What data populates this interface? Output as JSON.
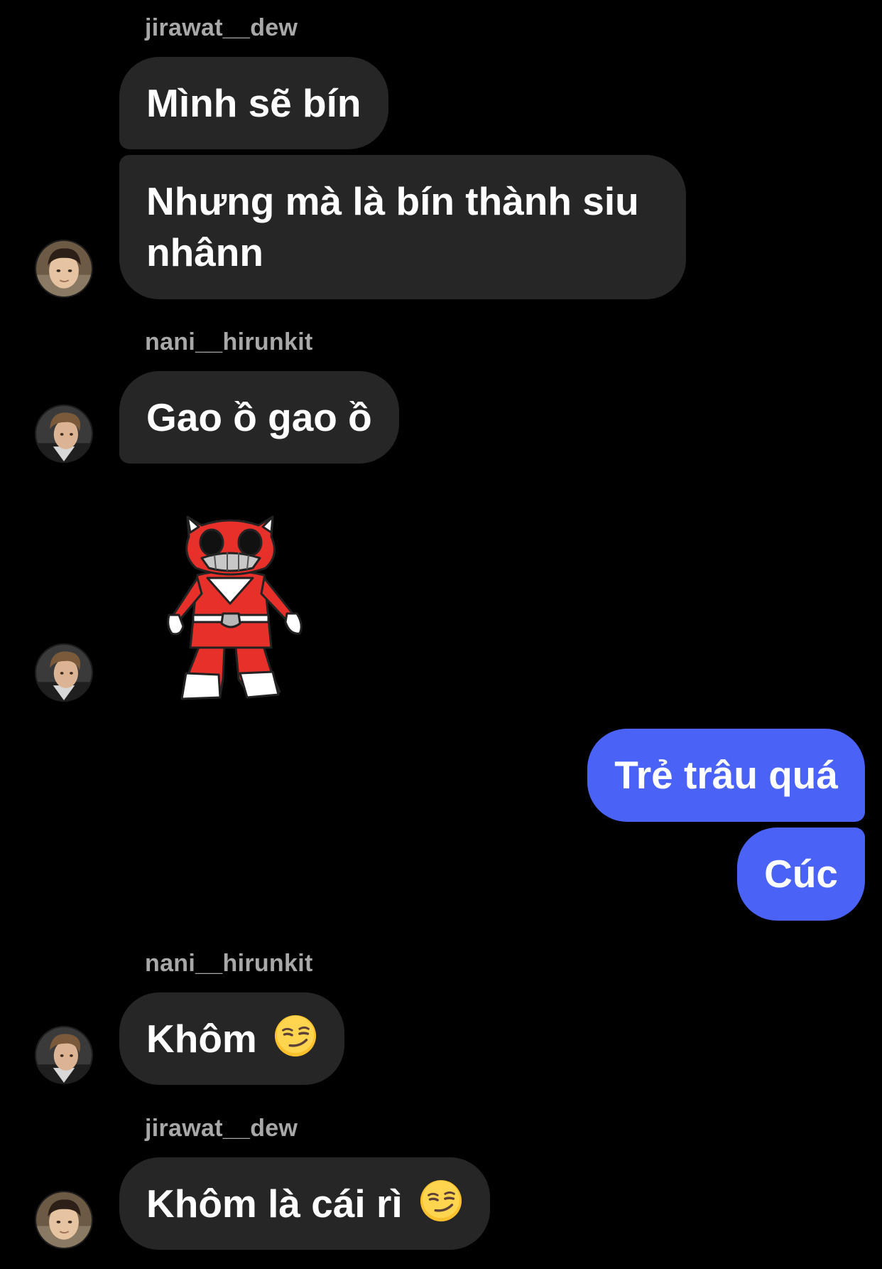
{
  "thread": {
    "groups": [
      {
        "sender": "jirawat__dew",
        "messages": [
          "Mình sẽ bín",
          "Nhưng mà là bín thành siu nhânn"
        ]
      },
      {
        "sender": "nani__hirunkit",
        "messages": [
          "Gao ồ gao ồ"
        ],
        "sticker": "red-ranger-cat-sticker"
      },
      {
        "outgoing": true,
        "messages": [
          "Trẻ trâu quá",
          "Cúc"
        ]
      },
      {
        "sender": "nani__hirunkit",
        "messages": [
          "Khôm"
        ],
        "emoji": "smirking-face-emoji"
      },
      {
        "sender": "jirawat__dew",
        "messages": [
          "Khôm là cái rì"
        ],
        "emoji": "smirking-face-emoji"
      }
    ]
  },
  "colors": {
    "background": "#000000",
    "incoming_bubble": "#262626",
    "outgoing_bubble": "#4a62f6",
    "sender_label": "#a8a8a8"
  }
}
